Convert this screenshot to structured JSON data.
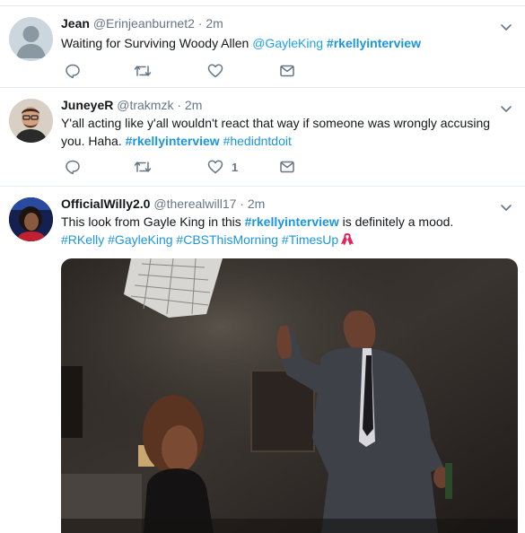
{
  "tweets": [
    {
      "name": "Jean",
      "handle": "@Erinjeanburnet2",
      "sep": "·",
      "time": "2m",
      "text_plain": "Waiting for Surviving Woody Allen ",
      "mention": "@GayleKing",
      "space": " ",
      "hashtag": "#rkellyinterview"
    },
    {
      "name": "JuneyeR",
      "handle": "@trakmzk",
      "sep": "·",
      "time": "2m",
      "line1": "Y'all acting like y'all wouldn't react that way if someone was wrongly accusing",
      "line2_plain": "you. Haha.  ",
      "hashtag1": "#rkellyinterview",
      "space": " ",
      "hashtag2": "#hedidntdoit",
      "like_count": "1"
    },
    {
      "name": "OfficialWilly2.0",
      "handle": "@therealwill17",
      "sep": "·",
      "time": "2m",
      "line1_plain": "This look from Gayle King in this ",
      "line1_hashtag": "#rkellyinterview",
      "line1_tail": " is definitely a mood.",
      "tags": [
        "#RKelly",
        "#GayleKing",
        "#CBSThisMorning",
        "#TimesUp"
      ]
    }
  ],
  "icons": {
    "reply": "reply-icon",
    "retweet": "retweet-icon",
    "like": "heart-icon",
    "dm": "envelope-icon",
    "caret": "chevron-down-icon",
    "emoji": "ribbon-emoji"
  },
  "colors": {
    "link": "#1b95e0",
    "meta": "#657786",
    "divider": "#e6ecf0"
  }
}
